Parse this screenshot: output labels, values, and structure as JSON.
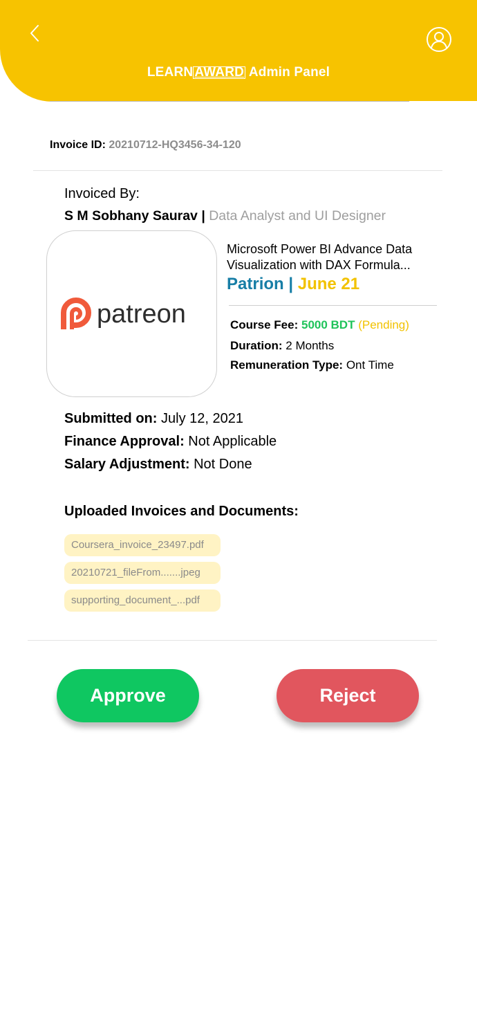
{
  "header": {
    "title_prefix": "LEARN",
    "title_brand": "AWARD",
    "title_suffix": "Admin Panel",
    "back_icon": "chevron-left-icon",
    "profile_icon": "user-circle-icon",
    "background_color": "#F7C300"
  },
  "invoice": {
    "id_label": "Invoice ID:",
    "id_value": "20210712-HQ3456-34-120"
  },
  "invoiced_by": {
    "label": "Invoiced By:",
    "name": "S M Sobhany Saurav",
    "separator": "|",
    "role": "Data Analyst and UI Designer"
  },
  "course": {
    "logo_text": "patreon",
    "title": "Microsoft Power BI Advance Data Visualization with DAX Formula...",
    "provider": "Patrion",
    "provider_separator": "|",
    "date": "June 21",
    "fee_label": "Course Fee:",
    "fee_value": "5000 BDT",
    "fee_status": "(Pending)",
    "duration_label": "Duration:",
    "duration_value": "2 Months",
    "remuneration_label": "Remuneration Type:",
    "remuneration_value": "Ont Time"
  },
  "meta": {
    "submitted_label": "Submitted on:",
    "submitted_value": "July 12, 2021",
    "finance_label": "Finance Approval:",
    "finance_value": "Not Applicable",
    "salary_label": "Salary Adjustment:",
    "salary_value": "Not Done"
  },
  "uploads": {
    "heading": "Uploaded Invoices and Documents:",
    "files": [
      "Coursera_invoice_23497.pdf",
      "20210721_fileFrom.......jpeg",
      "supporting_document_...pdf"
    ]
  },
  "actions": {
    "approve_label": "Approve",
    "reject_label": "Reject",
    "approve_color": "#0FC761",
    "reject_color": "#E1565E"
  }
}
